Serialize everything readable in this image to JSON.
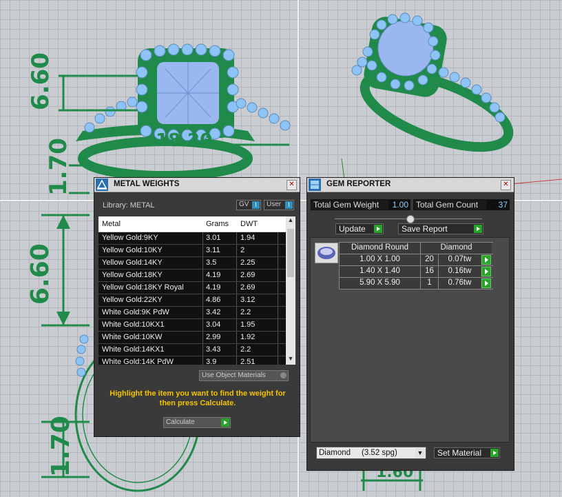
{
  "viewports": {
    "front_dims": [
      "6.60",
      "1.70",
      "18.20"
    ],
    "side_dims": [
      "6.60",
      "1.70"
    ],
    "top_dims": [
      "1.60"
    ]
  },
  "metal_weights": {
    "title": "METAL WEIGHTS",
    "library_label": "Library: METAL",
    "toggle_gv": "GV",
    "toggle_user": "User",
    "columns": [
      "Metal",
      "Grams",
      "DWT"
    ],
    "rows": [
      {
        "metal": "Yellow Gold:9KY",
        "grams": "3.01",
        "dwt": "1.94"
      },
      {
        "metal": "Yellow Gold:10KY",
        "grams": "3.11",
        "dwt": "2"
      },
      {
        "metal": "Yellow Gold:14KY",
        "grams": "3.5",
        "dwt": "2.25"
      },
      {
        "metal": "Yellow Gold:18KY",
        "grams": "4.19",
        "dwt": "2.69"
      },
      {
        "metal": "Yellow Gold:18KY Royal",
        "grams": "4.19",
        "dwt": "2.69"
      },
      {
        "metal": "Yellow Gold:22KY",
        "grams": "4.86",
        "dwt": "3.12"
      },
      {
        "metal": "White Gold:9K PdW",
        "grams": "3.42",
        "dwt": "2.2"
      },
      {
        "metal": "White Gold:10KX1",
        "grams": "3.04",
        "dwt": "1.95"
      },
      {
        "metal": "White Gold:10KW",
        "grams": "2.99",
        "dwt": "1.92"
      },
      {
        "metal": "White Gold:14KX1",
        "grams": "3.43",
        "dwt": "2.2"
      },
      {
        "metal": "White Gold:14K PdW",
        "grams": "3.9",
        "dwt": "2.51"
      }
    ],
    "use_object_materials": "Use Object Materials",
    "hint": "Highlight the item you want to find the weight for then press Calculate.",
    "calculate": "Calculate"
  },
  "gem_reporter": {
    "title": "GEM REPORTER",
    "total_gem_weight_label": "Total Gem Weight",
    "total_gem_weight": "1.00",
    "total_gem_count_label": "Total Gem Count",
    "total_gem_count": "37",
    "update": "Update",
    "save_report": "Save Report",
    "table_header": [
      "Diamond Round",
      "Diamond"
    ],
    "rows": [
      {
        "size": "1.00 X 1.00",
        "count": "20",
        "weight": "0.07tw"
      },
      {
        "size": "1.40 X 1.40",
        "count": "16",
        "weight": "0.16tw"
      },
      {
        "size": "5.90 X 5.90",
        "count": "1",
        "weight": "0.76tw"
      }
    ],
    "material_select": "Diamond     (3.52 spg)",
    "set_material": "Set Material"
  },
  "colors": {
    "ring_metal": "#1f8a4a",
    "gems": "#8ec4f5",
    "highlight_text": "#f5c400",
    "action_button": "#2aa32a"
  }
}
